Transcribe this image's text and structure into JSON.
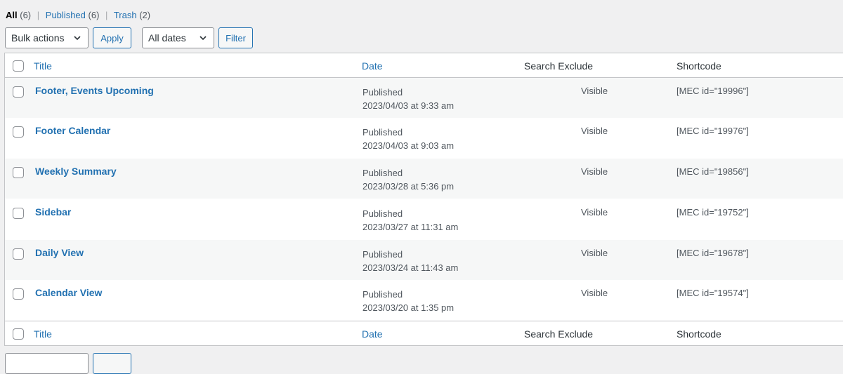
{
  "filters": {
    "all_label": "All",
    "all_count": "(6)",
    "published_label": "Published",
    "published_count": "(6)",
    "trash_label": "Trash",
    "trash_count": "(2)",
    "separator": "|"
  },
  "tablenav": {
    "bulk_actions": "Bulk actions",
    "apply": "Apply",
    "dates": "All dates",
    "filter": "Filter"
  },
  "columns": {
    "title": "Title",
    "date": "Date",
    "search_exclude": "Search Exclude",
    "shortcode": "Shortcode"
  },
  "rows": [
    {
      "title": "Footer, Events Upcoming",
      "status": "Published",
      "date": "2023/04/03 at 9:33 am",
      "exclude": "Visible",
      "shortcode": "[MEC id=\"19996\"]"
    },
    {
      "title": "Footer Calendar",
      "status": "Published",
      "date": "2023/04/03 at 9:03 am",
      "exclude": "Visible",
      "shortcode": "[MEC id=\"19976\"]"
    },
    {
      "title": "Weekly Summary",
      "status": "Published",
      "date": "2023/03/28 at 5:36 pm",
      "exclude": "Visible",
      "shortcode": "[MEC id=\"19856\"]"
    },
    {
      "title": "Sidebar",
      "status": "Published",
      "date": "2023/03/27 at 11:31 am",
      "exclude": "Visible",
      "shortcode": "[MEC id=\"19752\"]"
    },
    {
      "title": "Daily View",
      "status": "Published",
      "date": "2023/03/24 at 11:43 am",
      "exclude": "Visible",
      "shortcode": "[MEC id=\"19678\"]"
    },
    {
      "title": "Calendar View",
      "status": "Published",
      "date": "2023/03/20 at 1:35 pm",
      "exclude": "Visible",
      "shortcode": "[MEC id=\"19574\"]"
    }
  ],
  "icons": {
    "select_arrow": "chevron-down-icon"
  },
  "colors": {
    "link": "#2271b1",
    "border": "#c3c4c7",
    "alt_row": "#f6f7f7"
  }
}
